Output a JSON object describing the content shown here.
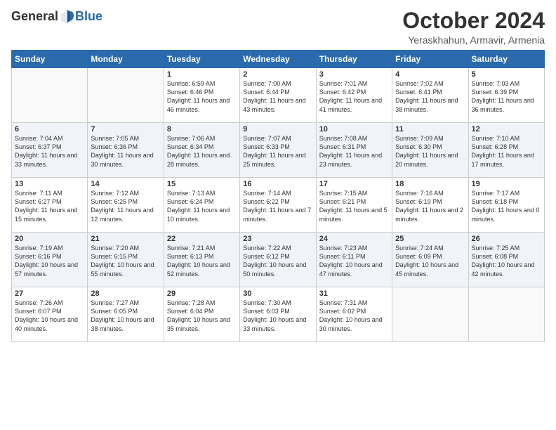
{
  "header": {
    "logo_general": "General",
    "logo_blue": "Blue",
    "month_title": "October 2024",
    "location": "Yeraskhahun, Armavir, Armenia"
  },
  "weekdays": [
    "Sunday",
    "Monday",
    "Tuesday",
    "Wednesday",
    "Thursday",
    "Friday",
    "Saturday"
  ],
  "weeks": [
    [
      {
        "num": "",
        "sunrise": "",
        "sunset": "",
        "daylight": ""
      },
      {
        "num": "",
        "sunrise": "",
        "sunset": "",
        "daylight": ""
      },
      {
        "num": "1",
        "sunrise": "Sunrise: 6:59 AM",
        "sunset": "Sunset: 6:46 PM",
        "daylight": "Daylight: 11 hours and 46 minutes."
      },
      {
        "num": "2",
        "sunrise": "Sunrise: 7:00 AM",
        "sunset": "Sunset: 6:44 PM",
        "daylight": "Daylight: 11 hours and 43 minutes."
      },
      {
        "num": "3",
        "sunrise": "Sunrise: 7:01 AM",
        "sunset": "Sunset: 6:42 PM",
        "daylight": "Daylight: 11 hours and 41 minutes."
      },
      {
        "num": "4",
        "sunrise": "Sunrise: 7:02 AM",
        "sunset": "Sunset: 6:41 PM",
        "daylight": "Daylight: 11 hours and 38 minutes."
      },
      {
        "num": "5",
        "sunrise": "Sunrise: 7:03 AM",
        "sunset": "Sunset: 6:39 PM",
        "daylight": "Daylight: 11 hours and 36 minutes."
      }
    ],
    [
      {
        "num": "6",
        "sunrise": "Sunrise: 7:04 AM",
        "sunset": "Sunset: 6:37 PM",
        "daylight": "Daylight: 11 hours and 33 minutes."
      },
      {
        "num": "7",
        "sunrise": "Sunrise: 7:05 AM",
        "sunset": "Sunset: 6:36 PM",
        "daylight": "Daylight: 11 hours and 30 minutes."
      },
      {
        "num": "8",
        "sunrise": "Sunrise: 7:06 AM",
        "sunset": "Sunset: 6:34 PM",
        "daylight": "Daylight: 11 hours and 28 minutes."
      },
      {
        "num": "9",
        "sunrise": "Sunrise: 7:07 AM",
        "sunset": "Sunset: 6:33 PM",
        "daylight": "Daylight: 11 hours and 25 minutes."
      },
      {
        "num": "10",
        "sunrise": "Sunrise: 7:08 AM",
        "sunset": "Sunset: 6:31 PM",
        "daylight": "Daylight: 11 hours and 23 minutes."
      },
      {
        "num": "11",
        "sunrise": "Sunrise: 7:09 AM",
        "sunset": "Sunset: 6:30 PM",
        "daylight": "Daylight: 11 hours and 20 minutes."
      },
      {
        "num": "12",
        "sunrise": "Sunrise: 7:10 AM",
        "sunset": "Sunset: 6:28 PM",
        "daylight": "Daylight: 11 hours and 17 minutes."
      }
    ],
    [
      {
        "num": "13",
        "sunrise": "Sunrise: 7:11 AM",
        "sunset": "Sunset: 6:27 PM",
        "daylight": "Daylight: 11 hours and 15 minutes."
      },
      {
        "num": "14",
        "sunrise": "Sunrise: 7:12 AM",
        "sunset": "Sunset: 6:25 PM",
        "daylight": "Daylight: 11 hours and 12 minutes."
      },
      {
        "num": "15",
        "sunrise": "Sunrise: 7:13 AM",
        "sunset": "Sunset: 6:24 PM",
        "daylight": "Daylight: 11 hours and 10 minutes."
      },
      {
        "num": "16",
        "sunrise": "Sunrise: 7:14 AM",
        "sunset": "Sunset: 6:22 PM",
        "daylight": "Daylight: 11 hours and 7 minutes."
      },
      {
        "num": "17",
        "sunrise": "Sunrise: 7:15 AM",
        "sunset": "Sunset: 6:21 PM",
        "daylight": "Daylight: 11 hours and 5 minutes."
      },
      {
        "num": "18",
        "sunrise": "Sunrise: 7:16 AM",
        "sunset": "Sunset: 6:19 PM",
        "daylight": "Daylight: 11 hours and 2 minutes."
      },
      {
        "num": "19",
        "sunrise": "Sunrise: 7:17 AM",
        "sunset": "Sunset: 6:18 PM",
        "daylight": "Daylight: 11 hours and 0 minutes."
      }
    ],
    [
      {
        "num": "20",
        "sunrise": "Sunrise: 7:19 AM",
        "sunset": "Sunset: 6:16 PM",
        "daylight": "Daylight: 10 hours and 57 minutes."
      },
      {
        "num": "21",
        "sunrise": "Sunrise: 7:20 AM",
        "sunset": "Sunset: 6:15 PM",
        "daylight": "Daylight: 10 hours and 55 minutes."
      },
      {
        "num": "22",
        "sunrise": "Sunrise: 7:21 AM",
        "sunset": "Sunset: 6:13 PM",
        "daylight": "Daylight: 10 hours and 52 minutes."
      },
      {
        "num": "23",
        "sunrise": "Sunrise: 7:22 AM",
        "sunset": "Sunset: 6:12 PM",
        "daylight": "Daylight: 10 hours and 50 minutes."
      },
      {
        "num": "24",
        "sunrise": "Sunrise: 7:23 AM",
        "sunset": "Sunset: 6:11 PM",
        "daylight": "Daylight: 10 hours and 47 minutes."
      },
      {
        "num": "25",
        "sunrise": "Sunrise: 7:24 AM",
        "sunset": "Sunset: 6:09 PM",
        "daylight": "Daylight: 10 hours and 45 minutes."
      },
      {
        "num": "26",
        "sunrise": "Sunrise: 7:25 AM",
        "sunset": "Sunset: 6:08 PM",
        "daylight": "Daylight: 10 hours and 42 minutes."
      }
    ],
    [
      {
        "num": "27",
        "sunrise": "Sunrise: 7:26 AM",
        "sunset": "Sunset: 6:07 PM",
        "daylight": "Daylight: 10 hours and 40 minutes."
      },
      {
        "num": "28",
        "sunrise": "Sunrise: 7:27 AM",
        "sunset": "Sunset: 6:05 PM",
        "daylight": "Daylight: 10 hours and 38 minutes."
      },
      {
        "num": "29",
        "sunrise": "Sunrise: 7:28 AM",
        "sunset": "Sunset: 6:04 PM",
        "daylight": "Daylight: 10 hours and 35 minutes."
      },
      {
        "num": "30",
        "sunrise": "Sunrise: 7:30 AM",
        "sunset": "Sunset: 6:03 PM",
        "daylight": "Daylight: 10 hours and 33 minutes."
      },
      {
        "num": "31",
        "sunrise": "Sunrise: 7:31 AM",
        "sunset": "Sunset: 6:02 PM",
        "daylight": "Daylight: 10 hours and 30 minutes."
      },
      {
        "num": "",
        "sunrise": "",
        "sunset": "",
        "daylight": ""
      },
      {
        "num": "",
        "sunrise": "",
        "sunset": "",
        "daylight": ""
      }
    ]
  ]
}
